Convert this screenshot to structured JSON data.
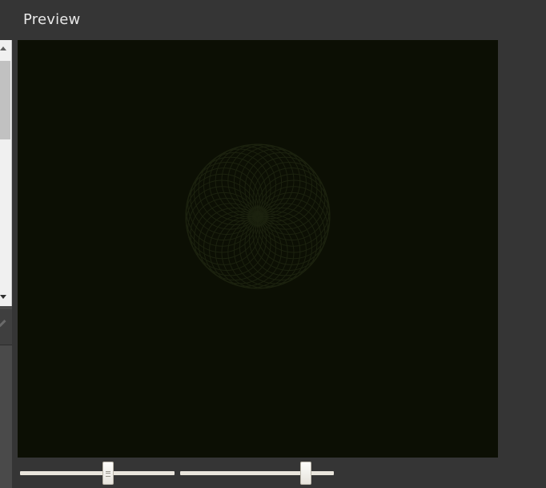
{
  "panel": {
    "title": "Preview"
  },
  "colors": {
    "background": "#353535",
    "canvas": "#0c0f04",
    "pattern_stroke": "#1c220f"
  },
  "sliders": [
    {
      "name": "slider-1",
      "value": 0.57
    },
    {
      "name": "slider-2",
      "value": 0.82
    }
  ],
  "icons": {
    "left_tool": "pencil-icon",
    "scroll_up": "arrow-up-icon",
    "scroll_down": "arrow-down-icon"
  }
}
